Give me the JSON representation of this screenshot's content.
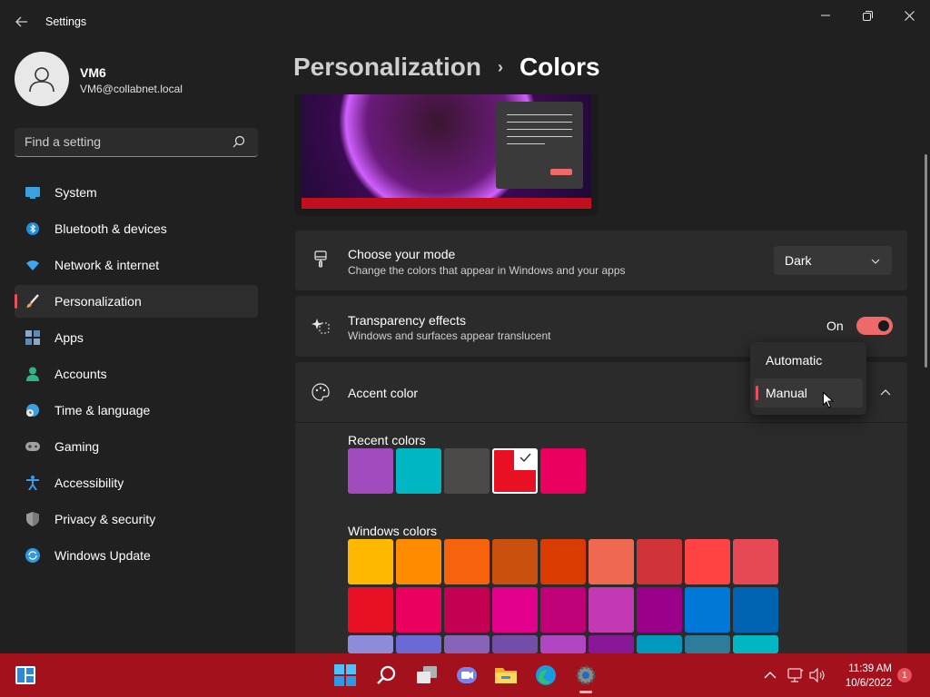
{
  "window": {
    "title": "Settings",
    "back_icon": "back-arrow-icon",
    "minimize_icon": "minimize-icon",
    "maximize_icon": "restore-icon",
    "close_icon": "close-icon"
  },
  "user": {
    "name": "VM6",
    "email": "VM6@collabnet.local"
  },
  "search": {
    "placeholder": "Find a setting"
  },
  "sidebar": {
    "items": [
      {
        "label": "System",
        "icon": "system-icon",
        "color": "#3aa0e0"
      },
      {
        "label": "Bluetooth & devices",
        "icon": "bluetooth-icon",
        "color": "#1e8de0"
      },
      {
        "label": "Network & internet",
        "icon": "wifi-icon",
        "color": "#3aa8f0"
      },
      {
        "label": "Personalization",
        "icon": "brush-icon",
        "color": "#e8a060"
      },
      {
        "label": "Apps",
        "icon": "apps-icon",
        "color": "#8aa8c8"
      },
      {
        "label": "Accounts",
        "icon": "person-icon",
        "color": "#2fb58a"
      },
      {
        "label": "Time & language",
        "icon": "globe-clock-icon",
        "color": "#3aa0e0"
      },
      {
        "label": "Gaming",
        "icon": "gamepad-icon",
        "color": "#a0a0a0"
      },
      {
        "label": "Accessibility",
        "icon": "accessibility-icon",
        "color": "#3a9ae8"
      },
      {
        "label": "Privacy & security",
        "icon": "shield-icon",
        "color": "#9a9a9a"
      },
      {
        "label": "Windows Update",
        "icon": "update-icon",
        "color": "#2f9ae0"
      }
    ],
    "active_index": 3
  },
  "breadcrumb": {
    "parent": "Personalization",
    "separator": "›",
    "current": "Colors"
  },
  "mode": {
    "title": "Choose your mode",
    "subtitle": "Change the colors that appear in Windows and your apps",
    "value": "Dark",
    "icon": "paintbrush-icon"
  },
  "transparency": {
    "title": "Transparency effects",
    "subtitle": "Windows and surfaces appear translucent",
    "state_label": "On",
    "on": true,
    "icon": "sparkle-icon"
  },
  "accent": {
    "title": "Accent color",
    "icon": "palette-icon",
    "options": [
      "Automatic",
      "Manual"
    ],
    "selected": "Manual",
    "recent_label": "Recent colors",
    "recent_colors": [
      "#a24bbf",
      "#00b7c3",
      "#4c4a48",
      "#e81123",
      "#ea005e"
    ],
    "recent_selected_index": 3,
    "windows_label": "Windows colors",
    "windows_colors": [
      [
        "#ffb900",
        "#ff8c00",
        "#f7630c",
        "#ca5010",
        "#da3b01",
        "#ef6950",
        "#d13438",
        "#ff4343",
        "#e74856"
      ],
      [
        "#e81123",
        "#ea005e",
        "#c30052",
        "#e3008c",
        "#bf0077",
        "#c239b3",
        "#9a0089",
        "#0078d7",
        "#0063b1"
      ],
      [
        "#8e8cd8",
        "#6b69d6",
        "#8764b8",
        "#744da9",
        "#b146c2",
        "#881798",
        "#0099bc",
        "#2d7d9a",
        "#00b7c3"
      ]
    ]
  },
  "taskbar": {
    "apps": [
      "start-icon",
      "search-icon",
      "task-view-icon",
      "chat-icon",
      "file-explorer-icon",
      "edge-icon",
      "settings-icon"
    ],
    "time": "11:39 AM",
    "date": "10/6/2022",
    "notification_count": "1"
  }
}
